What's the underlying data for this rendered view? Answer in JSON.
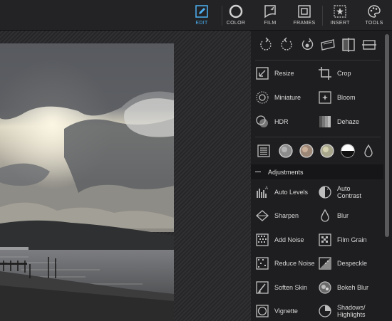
{
  "tabs": [
    {
      "label": "EDIT",
      "icon": "edit-icon",
      "active": true
    },
    {
      "label": "COLOR",
      "icon": "color-icon",
      "active": false
    },
    {
      "label": "FILM",
      "icon": "film-icon",
      "active": false
    },
    {
      "label": "FRAMES",
      "icon": "frames-icon",
      "active": false
    },
    {
      "label": "INSERT",
      "icon": "insert-icon",
      "active": false
    },
    {
      "label": "TOOLS",
      "icon": "tools-icon",
      "active": false
    }
  ],
  "transform_icons": [
    "rotate-left-icon",
    "rotate-right-icon",
    "rotate-free-icon",
    "straighten-icon",
    "flip-horizontal-icon",
    "flip-vertical-icon"
  ],
  "tools_top": [
    {
      "label": "Resize",
      "icon": "resize-icon"
    },
    {
      "label": "Crop",
      "icon": "crop-icon"
    },
    {
      "label": "Miniature",
      "icon": "miniature-icon"
    },
    {
      "label": "Bloom",
      "icon": "bloom-icon"
    },
    {
      "label": "HDR",
      "icon": "hdr-icon"
    },
    {
      "label": "Dehaze",
      "icon": "dehaze-icon"
    }
  ],
  "presets": [
    "list-icon",
    "gray-preset-icon",
    "warm-preset-icon",
    "cream-preset-icon",
    "bw-preset-icon",
    "drop-icon"
  ],
  "adjustments": {
    "title": "Adjustments",
    "items": [
      {
        "label": "Auto Levels",
        "icon": "auto-levels-icon"
      },
      {
        "label": "Auto\nContrast",
        "icon": "auto-contrast-icon"
      },
      {
        "label": "Sharpen",
        "icon": "sharpen-icon"
      },
      {
        "label": "Blur",
        "icon": "blur-icon"
      },
      {
        "label": "Add Noise",
        "icon": "add-noise-icon"
      },
      {
        "label": "Film Grain",
        "icon": "film-grain-icon"
      },
      {
        "label": "Reduce Noise",
        "icon": "reduce-noise-icon"
      },
      {
        "label": "Despeckle",
        "icon": "despeckle-icon"
      },
      {
        "label": "Soften Skin",
        "icon": "soften-skin-icon"
      },
      {
        "label": "Bokeh Blur",
        "icon": "bokeh-blur-icon"
      },
      {
        "label": "Vignette",
        "icon": "vignette-icon"
      },
      {
        "label": "Shadows/\nHighlights",
        "icon": "shadows-highlights-icon"
      }
    ]
  },
  "colors": {
    "accent": "#4db2f5",
    "panel": "#1e1e20",
    "text": "#d8d8d8"
  }
}
